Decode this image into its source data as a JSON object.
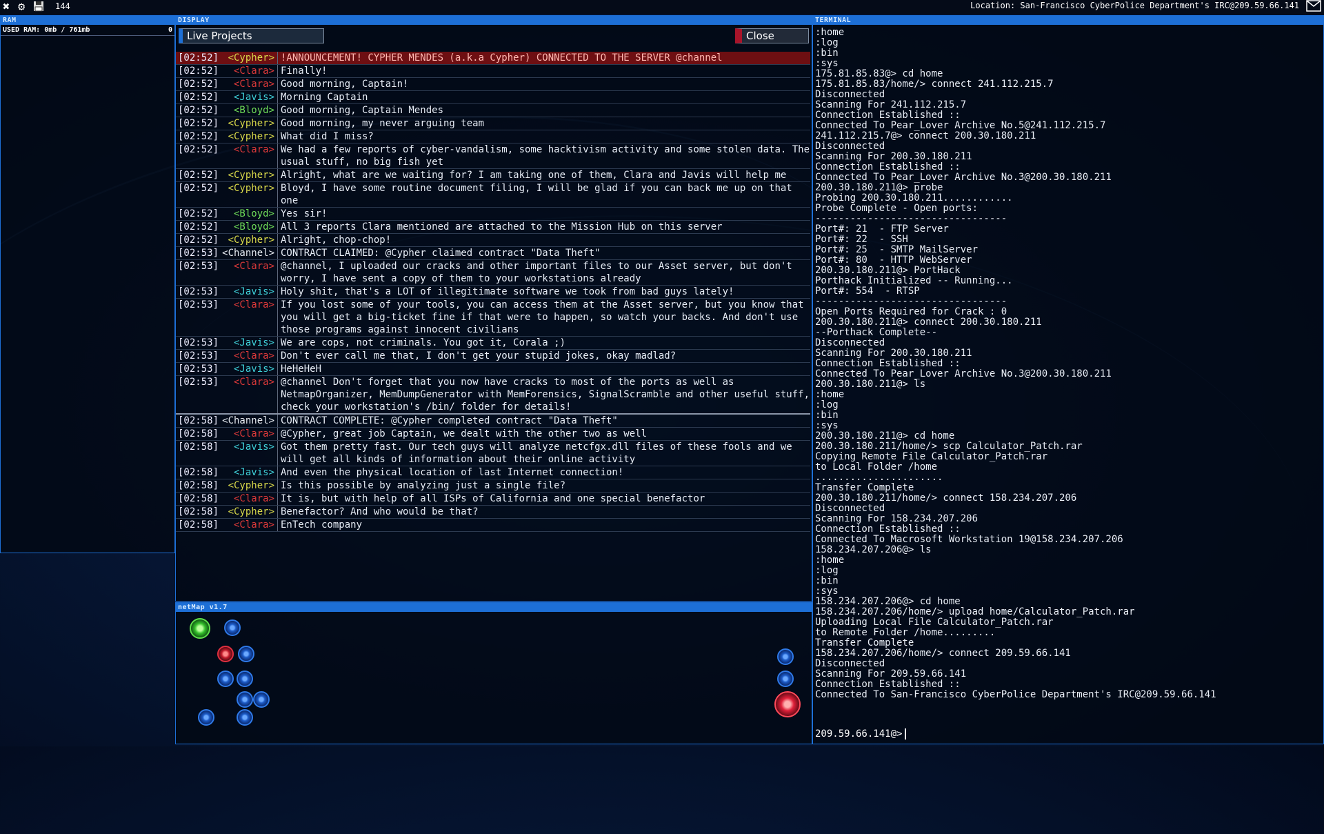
{
  "topbar": {
    "counter": "144",
    "location": "Location: San-Francisco CyberPolice Department's IRC@209.59.66.141"
  },
  "ram": {
    "title": "RAM",
    "used_label": "USED RAM: 0mb / 761mb",
    "count": "0"
  },
  "display": {
    "title": "DISPLAY",
    "project_button": "Live Projects",
    "close_button": "Close",
    "messages": [
      {
        "time": "[02:52]",
        "nick": "<Cypher>",
        "cls": "c-cypher",
        "text": "!ANNOUNCEMENT! CYPHER MENDES (a.k.a Cypher) CONNECTED TO THE SERVER @channel",
        "ann": true
      },
      {
        "time": "[02:52]",
        "nick": "<Clara>",
        "cls": "c-clara",
        "text": "Finally!"
      },
      {
        "time": "[02:52]",
        "nick": "<Clara>",
        "cls": "c-clara",
        "text": "Good morning, Captain!"
      },
      {
        "time": "[02:52]",
        "nick": "<Javis>",
        "cls": "c-javis",
        "text": "Morning Captain"
      },
      {
        "time": "[02:52]",
        "nick": "<Bloyd>",
        "cls": "c-bloyd",
        "text": "Good morning, Captain Mendes"
      },
      {
        "time": "[02:52]",
        "nick": "<Cypher>",
        "cls": "c-cypher",
        "text": "Good morning, my never arguing team"
      },
      {
        "time": "[02:52]",
        "nick": "<Cypher>",
        "cls": "c-cypher",
        "text": "What did I miss?"
      },
      {
        "time": "[02:52]",
        "nick": "<Clara>",
        "cls": "c-clara",
        "text": "We had a few reports of cyber-vandalism, some hacktivism activity and some stolen data. The usual stuff, no big fish yet"
      },
      {
        "time": "[02:52]",
        "nick": "<Cypher>",
        "cls": "c-cypher",
        "text": "Alright, what are we waiting for? I am taking one of them, Clara and Javis will help me"
      },
      {
        "time": "[02:52]",
        "nick": "<Cypher>",
        "cls": "c-cypher",
        "text": "Bloyd, I have some routine document filing, I will be glad if you can back me up on that one"
      },
      {
        "time": "[02:52]",
        "nick": "<Bloyd>",
        "cls": "c-bloyd",
        "text": "Yes sir!"
      },
      {
        "time": "[02:52]",
        "nick": "<Bloyd>",
        "cls": "c-bloyd",
        "text": "All 3 reports Clara mentioned are attached to the Mission Hub on this server"
      },
      {
        "time": "[02:52]",
        "nick": "<Cypher>",
        "cls": "c-cypher",
        "text": "Alright, chop-chop!"
      },
      {
        "time": "[02:53]",
        "nick": "<Channel>",
        "cls": "c-channel",
        "text": "CONTRACT CLAIMED: @Cypher claimed contract \"Data Theft\""
      },
      {
        "time": "[02:53]",
        "nick": "<Clara>",
        "cls": "c-clara",
        "text": "@channel, I uploaded our cracks and other important files to our Asset server, but don't worry, I have sent a copy of them to your workstations already"
      },
      {
        "time": "[02:53]",
        "nick": "<Javis>",
        "cls": "c-javis",
        "text": "Holy shit, that's a LOT of illegitimate software we took from bad guys lately!"
      },
      {
        "time": "[02:53]",
        "nick": "<Clara>",
        "cls": "c-clara",
        "text": "If you lost some of your tools, you can access them at the Asset server, but you know that you will get a big-ticket fine if that were to happen, so watch your backs. And don't use those programs against innocent civilians"
      },
      {
        "time": "[02:53]",
        "nick": "<Javis>",
        "cls": "c-javis",
        "text": "We are cops, not criminals. You got it, Corala ;)"
      },
      {
        "time": "[02:53]",
        "nick": "<Clara>",
        "cls": "c-clara",
        "text": "Don't ever call me that, I don't get your stupid jokes, okay madlad?"
      },
      {
        "time": "[02:53]",
        "nick": "<Javis>",
        "cls": "c-javis",
        "text": "HeHeHeH"
      },
      {
        "time": "[02:53]",
        "nick": "<Clara>",
        "cls": "c-clara",
        "text": "@channel Don't forget that you now have cracks to most of the ports as well as NetmapOrganizer, MemDumpGenerator with MemForensics, SignalScramble and other useful stuff, check your workstation's /bin/ folder for details!",
        "sep": true
      },
      {
        "time": "[02:58]",
        "nick": "<Channel>",
        "cls": "c-channel",
        "text": "CONTRACT COMPLETE: @Cypher completed contract \"Data Theft\""
      },
      {
        "time": "[02:58]",
        "nick": "<Clara>",
        "cls": "c-clara",
        "text": "@Cypher, great job Captain, we dealt with the other two as well"
      },
      {
        "time": "[02:58]",
        "nick": "<Javis>",
        "cls": "c-javis",
        "text": "Got them pretty fast. Our tech guys will analyze netcfgx.dll files of these fools and we will get all kinds of information about their online activity"
      },
      {
        "time": "[02:58]",
        "nick": "<Javis>",
        "cls": "c-javis",
        "text": "And even the physical location of last Internet connection!"
      },
      {
        "time": "[02:58]",
        "nick": "<Cypher>",
        "cls": "c-cypher",
        "text": "Is this possible by analyzing just a single file?"
      },
      {
        "time": "[02:58]",
        "nick": "<Clara>",
        "cls": "c-clara",
        "text": "It is, but with help of all ISPs of California and one special benefactor"
      },
      {
        "time": "[02:58]",
        "nick": "<Cypher>",
        "cls": "c-cypher",
        "text": "Benefactor? And who would be that?"
      },
      {
        "time": "[02:58]",
        "nick": "<Clara>",
        "cls": "c-clara",
        "text": "EnTech company"
      }
    ]
  },
  "netmap": {
    "title": "netMap v1.7"
  },
  "terminal": {
    "title": "TERMINAL",
    "lines": [
      ":home",
      ":log",
      ":bin",
      ":sys",
      "175.81.85.83@> cd home",
      "175.81.85.83/home/> connect 241.112.215.7",
      "Disconnected",
      "Scanning For 241.112.215.7",
      "Connection Established ::",
      "Connected To Pear_Lover Archive No.5@241.112.215.7",
      "241.112.215.7@> connect 200.30.180.211",
      "Disconnected",
      "Scanning For 200.30.180.211",
      "Connection Established ::",
      "Connected To Pear_Lover Archive No.3@200.30.180.211",
      "200.30.180.211@> probe",
      "Probing 200.30.180.211............",
      "Probe Complete - Open ports:",
      "---------------------------------",
      "Port#: 21  - FTP Server",
      "Port#: 22  - SSH",
      "Port#: 25  - SMTP MailServer",
      "Port#: 80  - HTTP WebServer",
      "200.30.180.211@> PortHack",
      "Porthack Initialized -- Running...",
      "Port#: 554  - RTSP",
      "---------------------------------",
      "Open Ports Required for Crack : 0",
      "200.30.180.211@> connect 200.30.180.211",
      "--Porthack Complete--",
      "Disconnected",
      "Scanning For 200.30.180.211",
      "Connection Established ::",
      "Connected To Pear_Lover Archive No.3@200.30.180.211",
      "200.30.180.211@> ls",
      ":home",
      ":log",
      ":bin",
      ":sys",
      "200.30.180.211@> cd home",
      "200.30.180.211/home/> scp Calculator_Patch.rar",
      "Copying Remote File Calculator_Patch.rar",
      "to Local Folder /home",
      "......................",
      "Transfer Complete",
      "200.30.180.211/home/> connect 158.234.207.206",
      "Disconnected",
      "Scanning For 158.234.207.206",
      "Connection Established ::",
      "Connected To Macrosoft Workstation 19@158.234.207.206",
      "158.234.207.206@> ls",
      ":home",
      ":log",
      ":bin",
      ":sys",
      "158.234.207.206@> cd home",
      "158.234.207.206/home/> upload home/Calculator_Patch.rar",
      "Uploading Local File Calculator_Patch.rar",
      "to Remote Folder /home.........",
      "Transfer Complete",
      "158.234.207.206/home/> connect 209.59.66.141",
      "Disconnected",
      "Scanning For 209.59.66.141",
      "Connection Established ::",
      "Connected To San-Francisco CyberPolice Department's IRC@209.59.66.141"
    ],
    "prompt": "209.59.66.141@>"
  }
}
